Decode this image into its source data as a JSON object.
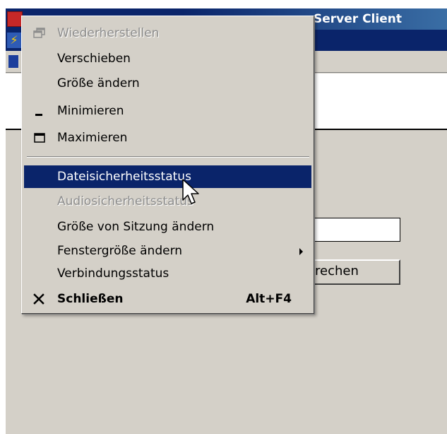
{
  "window": {
    "title": "Server Client",
    "cancel_button_label": "rechen",
    "input_value": ""
  },
  "context_menu": {
    "items": [
      {
        "label": "Wiederherstellen",
        "icon": "restore-icon",
        "enabled": false
      },
      {
        "label": "Verschieben",
        "enabled": true
      },
      {
        "label": "Größe ändern",
        "enabled": true
      },
      {
        "label": "Minimieren",
        "icon": "minimize-icon",
        "enabled": true
      },
      {
        "label": "Maximieren",
        "icon": "maximize-icon",
        "enabled": true
      },
      {
        "label": "Dateisicherheitsstatus",
        "enabled": true,
        "highlighted": true
      },
      {
        "label": "Audiosicherheitsstatus",
        "enabled": false
      },
      {
        "label": "Größe von Sitzung ändern",
        "enabled": true
      },
      {
        "label": "Fenstergröße ändern",
        "enabled": true,
        "submenu": true
      },
      {
        "label": "Verbindungsstatus",
        "enabled": true
      },
      {
        "label": "Schließen",
        "icon": "close-icon",
        "shortcut": "Alt+F4",
        "enabled": true,
        "bold": true
      }
    ]
  },
  "colors": {
    "highlight": "#0a246a",
    "menu_bg": "#d4d0c8",
    "disabled_text": "#8d8d8d",
    "titlebar": "#0a246a"
  }
}
